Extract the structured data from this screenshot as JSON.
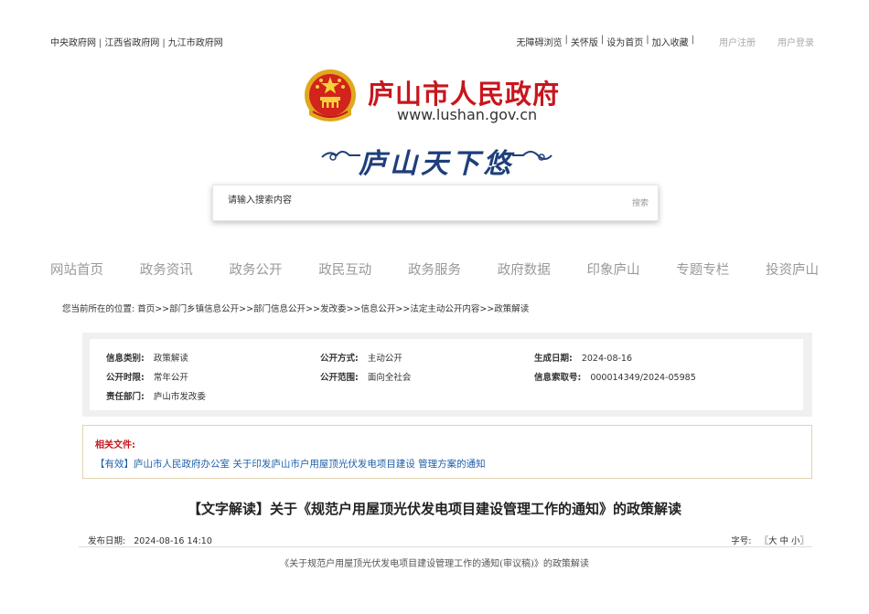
{
  "top_links_left": [
    "中央政府网",
    "江西省政府网",
    "九江市政府网"
  ],
  "top_links_right": [
    "无障碍浏览",
    "关怀版",
    "设为首页",
    "加入收藏"
  ],
  "user_links": [
    "用户注册",
    "用户登录"
  ],
  "logo": {
    "name": "庐山市人民政府",
    "url": "www.lushan.gov.cn"
  },
  "slogan": "庐山天下悠",
  "search": {
    "placeholder": "请输入搜索内容",
    "button": "搜索"
  },
  "nav": [
    "网站首页",
    "政务资讯",
    "政务公开",
    "政民互动",
    "政务服务",
    "政府数据",
    "印象庐山",
    "专题专栏",
    "投资庐山"
  ],
  "breadcrumb": "您当前所在的位置: 首页>>部门乡镇信息公开>>部门信息公开>>发改委>>信息公开>>法定主动公开内容>>政策解读",
  "info": {
    "category_label": "信息类别:",
    "category": "政策解读",
    "method_label": "公开方式:",
    "method": "主动公开",
    "date_label": "生成日期:",
    "date": "2024-08-16",
    "period_label": "公开时限:",
    "period": "常年公开",
    "scope_label": "公开范围:",
    "scope": "面向全社会",
    "index_label": "信息索取号:",
    "index": "000014349/2024-05985",
    "dept_label": "责任部门:",
    "dept": "庐山市发改委"
  },
  "related": {
    "title": "相关文件:",
    "link": "【有效】庐山市人民政府办公室 关于印发庐山市户用屋顶光伏发电项目建设 管理方案的通知"
  },
  "article": {
    "title": "【文字解读】关于《规范户用屋顶光伏发电项目建设管理工作的通知》的政策解读",
    "publish_label": "发布日期:",
    "publish_date": "2024-08-16 14:10",
    "font_size_label": "字号:",
    "font_size_options": "〖大 中 小〗",
    "subtitle": "《关于规范户用屋顶光伏发电项目建设管理工作的通知(审议稿)》的政策解读"
  },
  "colors": {
    "brand_red": "#c8161d",
    "link_blue": "#1e5fa8",
    "nav_gray": "#999999"
  }
}
